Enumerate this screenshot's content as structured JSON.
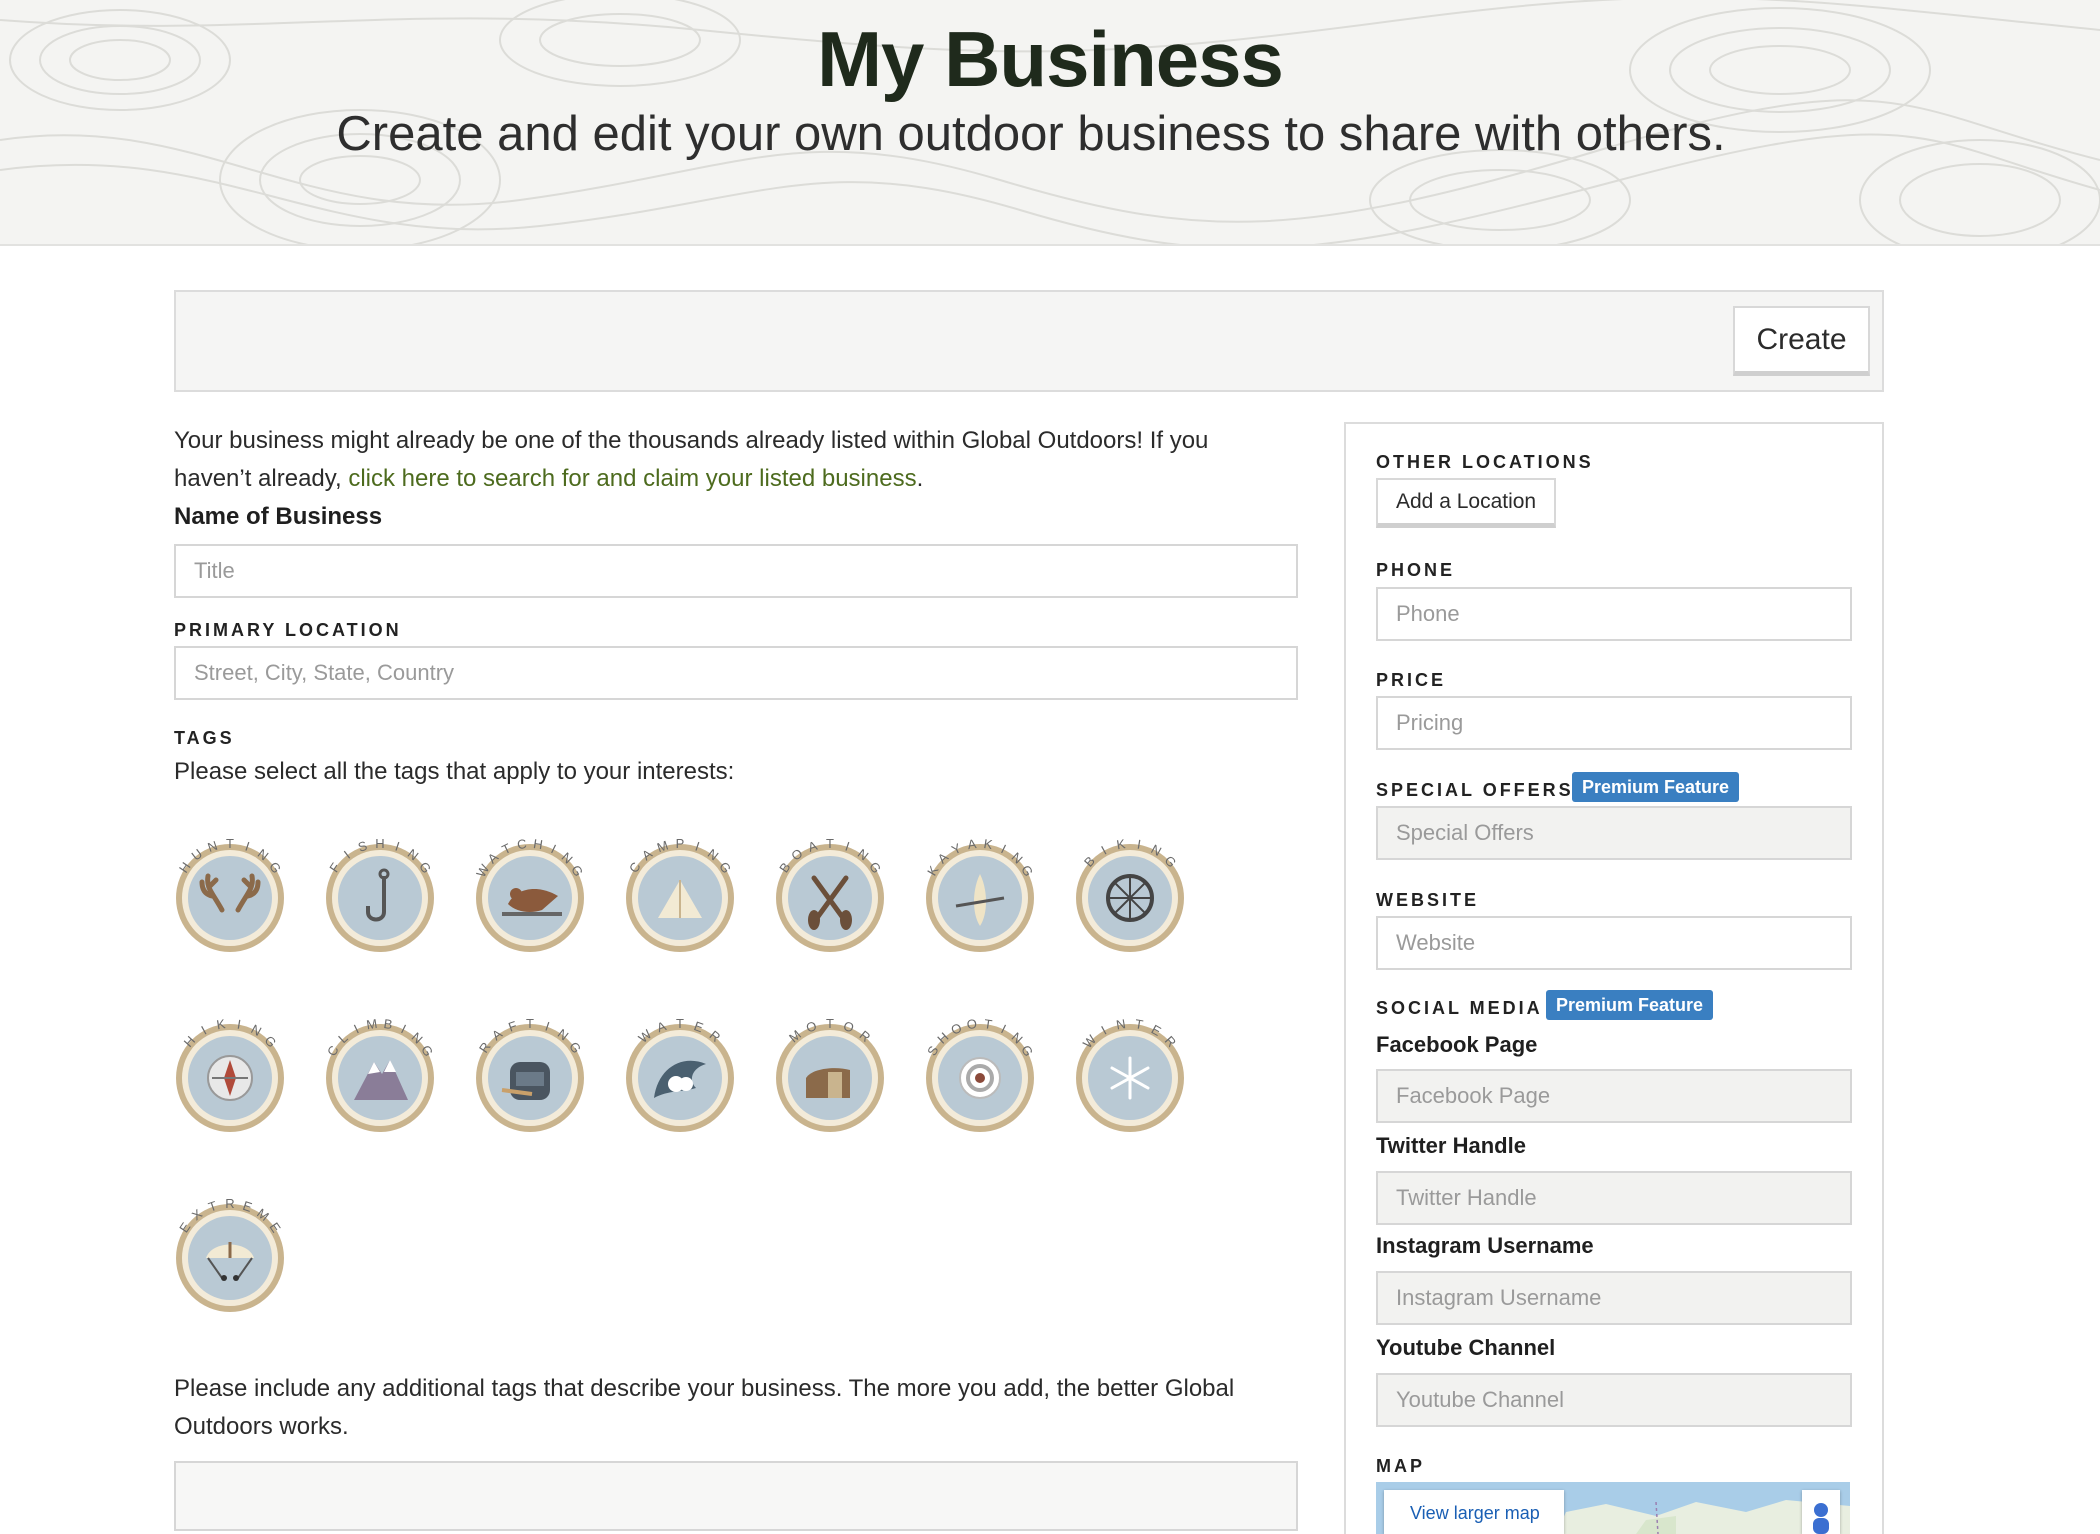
{
  "header": {
    "title": "My Business",
    "subtitle": "Create and edit your own outdoor business to share with others."
  },
  "toolbar": {
    "create_label": "Create"
  },
  "intro": {
    "text_before": "Your business might already be one of the thousands already listed within Global Outdoors! If you haven’t already, ",
    "link_text": "click here to search for and claim your listed business",
    "text_after": "."
  },
  "form": {
    "name_label": "Name of Business",
    "name_placeholder": "Title",
    "location_label": "PRIMARY LOCATION",
    "location_placeholder": "Street, City, State, Country",
    "tags_label": "TAGS",
    "tags_hint": "Please select all the tags that apply to your interests:",
    "extra_hint": "Please include any additional tags that describe your business. The more you add, the better Global Outdoors works."
  },
  "tags": [
    {
      "label": "HUNTING",
      "icon": "antlers-icon"
    },
    {
      "label": "FISHING",
      "icon": "fish-hook-icon"
    },
    {
      "label": "WATCHING",
      "icon": "bird-icon"
    },
    {
      "label": "CAMPING",
      "icon": "tent-icon"
    },
    {
      "label": "BOATING",
      "icon": "paddles-icon"
    },
    {
      "label": "KAYAKING",
      "icon": "kayak-icon"
    },
    {
      "label": "BIKING",
      "icon": "bike-wheel-icon"
    },
    {
      "label": "HIKING",
      "icon": "compass-icon"
    },
    {
      "label": "CLIMBING",
      "icon": "mountain-icon"
    },
    {
      "label": "RAFTING",
      "icon": "raft-icon"
    },
    {
      "label": "WATER",
      "icon": "wave-icon"
    },
    {
      "label": "MOTOR",
      "icon": "trailer-icon"
    },
    {
      "label": "SHOOTING",
      "icon": "target-icon"
    },
    {
      "label": "WINTER",
      "icon": "snowflake-icon"
    },
    {
      "label": "EXTREME",
      "icon": "parachute-icon"
    }
  ],
  "sidebar": {
    "other_locations_label": "OTHER LOCATIONS",
    "add_location_label": "Add a Location",
    "phone_label": "PHONE",
    "phone_placeholder": "Phone",
    "price_label": "PRICE",
    "price_placeholder": "Pricing",
    "special_offers_label": "SPECIAL OFFERS",
    "special_offers_placeholder": "Special Offers",
    "website_label": "WEBSITE",
    "website_placeholder": "Website",
    "social_label": "SOCIAL MEDIA",
    "premium_label": "Premium Feature",
    "facebook_label": "Facebook Page",
    "facebook_placeholder": "Facebook Page",
    "twitter_label": "Twitter Handle",
    "twitter_placeholder": "Twitter Handle",
    "instagram_label": "Instagram Username",
    "instagram_placeholder": "Instagram Username",
    "youtube_label": "Youtube Channel",
    "youtube_placeholder": "Youtube Channel",
    "map_label": "MAP",
    "map_link": "View larger map"
  },
  "colors": {
    "accent_green": "#4d6b1e",
    "premium_blue": "#3a7fc1",
    "badge_rim": "#c9b48e",
    "badge_bg": "#b9c9d4"
  }
}
